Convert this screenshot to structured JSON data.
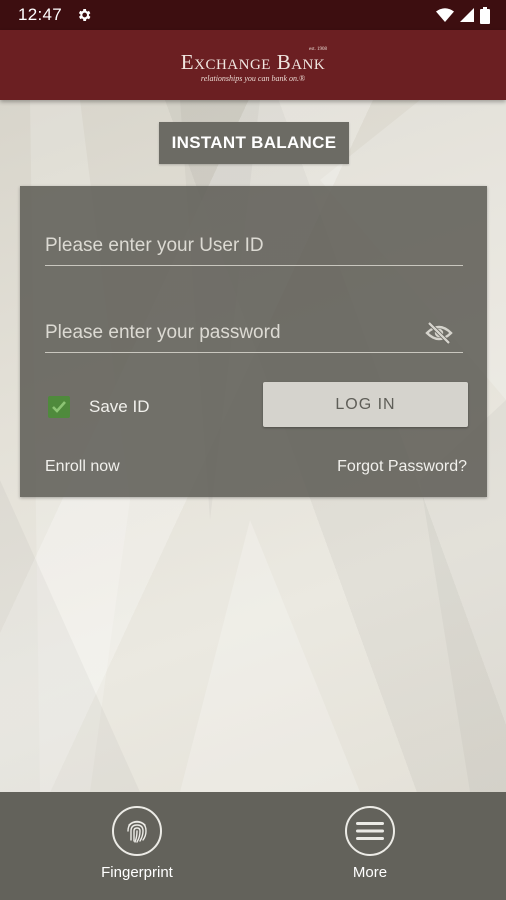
{
  "status_bar": {
    "time": "12:47",
    "icons": [
      "settings-icon",
      "wifi-icon",
      "signal-icon",
      "battery-icon"
    ]
  },
  "app_bar": {
    "logo_name": "Exchange Bank",
    "logo_est": "est. 1908",
    "logo_tagline": "relationships you can bank on.®"
  },
  "instant_balance": {
    "label": "INSTANT BALANCE"
  },
  "login_form": {
    "user_id_placeholder": "Please enter your User ID",
    "password_placeholder": "Please enter your password",
    "save_id_label": "Save ID",
    "save_id_checked": true,
    "login_label": "LOG IN",
    "enroll_label": "Enroll now",
    "forgot_label": "Forgot Password?"
  },
  "bottom_nav": {
    "items": [
      {
        "label": "Fingerprint",
        "icon": "fingerprint-icon"
      },
      {
        "label": "More",
        "icon": "menu-icon"
      }
    ]
  },
  "colors": {
    "status_bar": "#3d0e10",
    "app_bar": "#6b1f22",
    "card": "#605f58",
    "checkbox": "#4f8a3c",
    "bottom_bar": "#63625b"
  }
}
